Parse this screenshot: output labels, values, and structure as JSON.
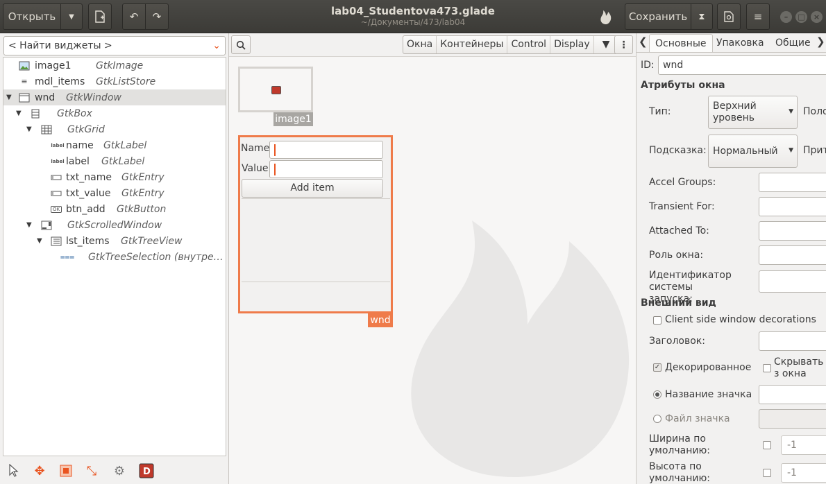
{
  "header": {
    "open_label": "Открыть",
    "title": "lab04_Studentova473.glade",
    "subtitle": "~/Документы/473/lab04",
    "save_label": "Сохранить"
  },
  "left": {
    "search_placeholder": "< Найти виджеты >",
    "tree": [
      {
        "name": "image1",
        "type": "GtkImage",
        "icon": "image-icon"
      },
      {
        "name": "mdl_items",
        "type": "GtkListStore",
        "icon": "liststore-icon"
      },
      {
        "name": "wnd",
        "type": "GtkWindow",
        "icon": "window-icon"
      },
      {
        "name": "",
        "type": "GtkBox",
        "icon": "box-icon"
      },
      {
        "name": "",
        "type": "GtkGrid",
        "icon": "grid-icon"
      },
      {
        "name": "name",
        "type": "GtkLabel",
        "icon": "label-icon"
      },
      {
        "name": "label",
        "type": "GtkLabel",
        "icon": "label-icon"
      },
      {
        "name": "txt_name",
        "type": "GtkEntry",
        "icon": "entry-icon"
      },
      {
        "name": "txt_value",
        "type": "GtkEntry",
        "icon": "entry-icon"
      },
      {
        "name": "btn_add",
        "type": "GtkButton",
        "icon": "button-icon"
      },
      {
        "name": "",
        "type": "GtkScrolledWindow",
        "icon": "scrolledwindow-icon"
      },
      {
        "name": "lst_items",
        "type": "GtkTreeView",
        "icon": "treeview-icon"
      },
      {
        "name": "",
        "type": "GtkTreeSelection (внутре…",
        "icon": "treeselection-icon"
      }
    ],
    "label_icon_text": "label",
    "button_icon_text": "OK"
  },
  "center": {
    "toolbar": [
      "Окна",
      "Контейнеры",
      "Control",
      "Display"
    ],
    "image_widget_label": "image1",
    "window_label": "wnd",
    "form": {
      "name_label": "Name",
      "value_label": "Value",
      "add_button": "Add item"
    }
  },
  "right": {
    "tabs": [
      "Основные",
      "Упаковка",
      "Общие"
    ],
    "id_label": "ID:",
    "id_value": "wnd",
    "section_window": "Атрибуты окна",
    "type_label": "Тип:",
    "type_value": "Верхний уровень",
    "position_label": "Поло",
    "hint_label": "Подсказка:",
    "hint_value": "Нормальный",
    "hint_right": "Прит",
    "accel_label": "Accel Groups:",
    "transient_label": "Transient For:",
    "attached_label": "Attached To:",
    "role_label": "Роль окна:",
    "startup_label": "Идентификатор системы запуска:",
    "section_look": "Внешний вид",
    "csd_label": "Client side window decorations",
    "title_label": "Заголовок:",
    "decorated_label": "Декорированное",
    "hide_label": "Скрывать з окна",
    "icon_name_label": "Название значка",
    "icon_file_label": "Файл значка",
    "width_label": "Ширина по умолчанию:",
    "width_value": "-1",
    "height_label": "Высота по умолчанию:",
    "height_value": "-1"
  }
}
